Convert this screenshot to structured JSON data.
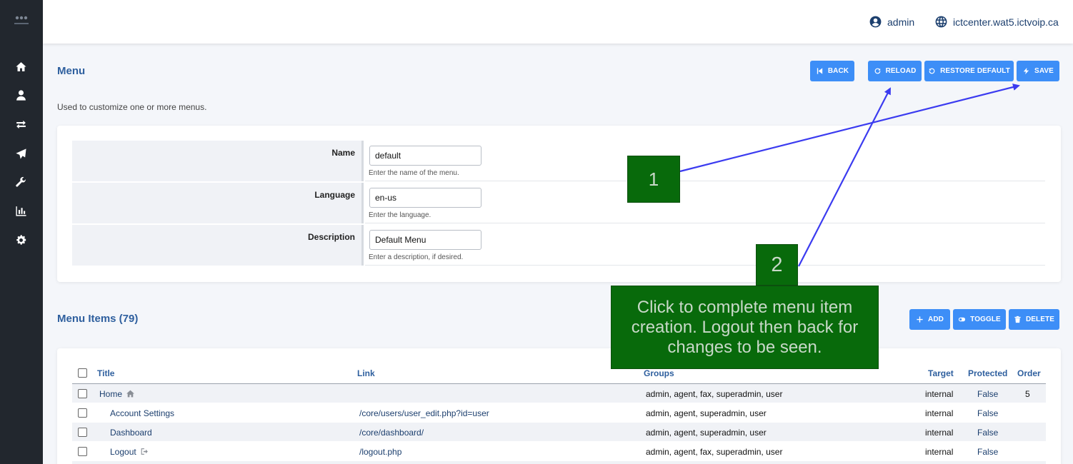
{
  "header": {
    "username": "admin",
    "domain": "ictcenter.wat5.ictvoip.ca"
  },
  "sidebar": {
    "icons": [
      "home-icon",
      "user-icon",
      "transfer-icon",
      "paper-plane-icon",
      "wrench-icon",
      "chart-icon",
      "gear-icon"
    ]
  },
  "page": {
    "title": "Menu",
    "description": "Used to customize one or more menus.",
    "buttons": {
      "back": "BACK",
      "reload": "RELOAD",
      "restore": "RESTORE DEFAULT",
      "save": "SAVE"
    }
  },
  "form": {
    "fields": [
      {
        "label": "Name",
        "value": "default",
        "hint": "Enter the name of the menu."
      },
      {
        "label": "Language",
        "value": "en-us",
        "hint": "Enter the language."
      },
      {
        "label": "Description",
        "value": "Default Menu",
        "hint": "Enter a description, if desired."
      }
    ]
  },
  "menu_items": {
    "title": "Menu Items (79)",
    "buttons": {
      "add": "ADD",
      "toggle": "TOGGLE",
      "delete": "DELETE"
    },
    "columns": {
      "title": "Title",
      "link": "Link",
      "groups": "Groups",
      "target": "Target",
      "protected": "Protected",
      "order": "Order"
    },
    "rows": [
      {
        "title": "Home",
        "link": "",
        "groups": "admin, agent, fax, superadmin, user",
        "target": "internal",
        "protected": "False",
        "order": "5"
      },
      {
        "title": "Account Settings",
        "link": "/core/users/user_edit.php?id=user",
        "groups": "admin, agent, superadmin, user",
        "target": "internal",
        "protected": "False",
        "order": ""
      },
      {
        "title": "Dashboard",
        "link": "/core/dashboard/",
        "groups": "admin, agent, superadmin, user",
        "target": "internal",
        "protected": "False",
        "order": ""
      },
      {
        "title": "Logout",
        "link": "/logout.php",
        "groups": "admin, agent, fax, superadmin, user",
        "target": "internal",
        "protected": "False",
        "order": ""
      }
    ]
  },
  "annotations": {
    "callout_1": "1",
    "callout_2": "2",
    "callout_text": "Click to complete menu item creation. Logout then back for changes to be seen.",
    "arrow_color": "#3b3bf0",
    "callout_color": "#086a0b"
  }
}
